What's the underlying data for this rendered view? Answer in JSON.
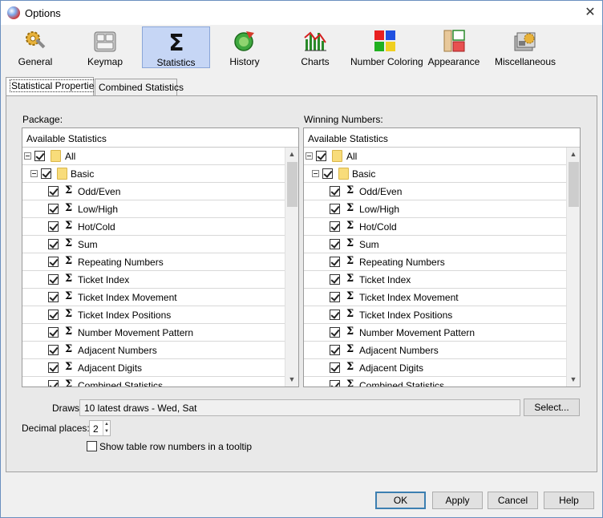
{
  "window": {
    "title": "Options"
  },
  "toolbar": {
    "items": [
      {
        "label": "General",
        "icon": "gears-icon"
      },
      {
        "label": "Keymap",
        "icon": "keyboard-icon"
      },
      {
        "label": "Statistics",
        "icon": "sigma-icon"
      },
      {
        "label": "History",
        "icon": "history-icon"
      },
      {
        "label": "Charts",
        "icon": "chart-icon"
      },
      {
        "label": "Number Coloring",
        "icon": "color-squares-icon"
      },
      {
        "label": "Appearance",
        "icon": "appearance-icon"
      },
      {
        "label": "Miscellaneous",
        "icon": "misc-icon"
      }
    ],
    "active": "Statistics"
  },
  "tabs": [
    "Statistical Properties",
    "Combined Statistics"
  ],
  "package": {
    "label": "Package:",
    "header": "Available Statistics",
    "root": "All",
    "group": "Basic",
    "items": [
      "Odd/Even",
      "Low/High",
      "Hot/Cold",
      "Sum",
      "Repeating Numbers",
      "Ticket Index",
      "Ticket Index Movement",
      "Ticket Index Positions",
      "Number Movement Pattern",
      "Adjacent Numbers",
      "Adjacent Digits",
      "Combined Statistics"
    ]
  },
  "winning": {
    "label": "Winning Numbers:",
    "header": "Available Statistics",
    "root": "All",
    "group": "Basic",
    "items": [
      "Odd/Even",
      "Low/High",
      "Hot/Cold",
      "Sum",
      "Repeating Numbers",
      "Ticket Index",
      "Ticket Index Movement",
      "Ticket Index Positions",
      "Number Movement Pattern",
      "Adjacent Numbers",
      "Adjacent Digits",
      "Combined Statistics"
    ]
  },
  "draws": {
    "label": "Draws:",
    "value": "10 latest draws - Wed, Sat",
    "select_button": "Select..."
  },
  "decimal": {
    "label": "Decimal places:",
    "value": "2"
  },
  "tooltip_option": {
    "label": "Show table row numbers in a tooltip",
    "checked": false
  },
  "buttons": {
    "ok": "OK",
    "apply": "Apply",
    "cancel": "Cancel",
    "help": "Help"
  }
}
